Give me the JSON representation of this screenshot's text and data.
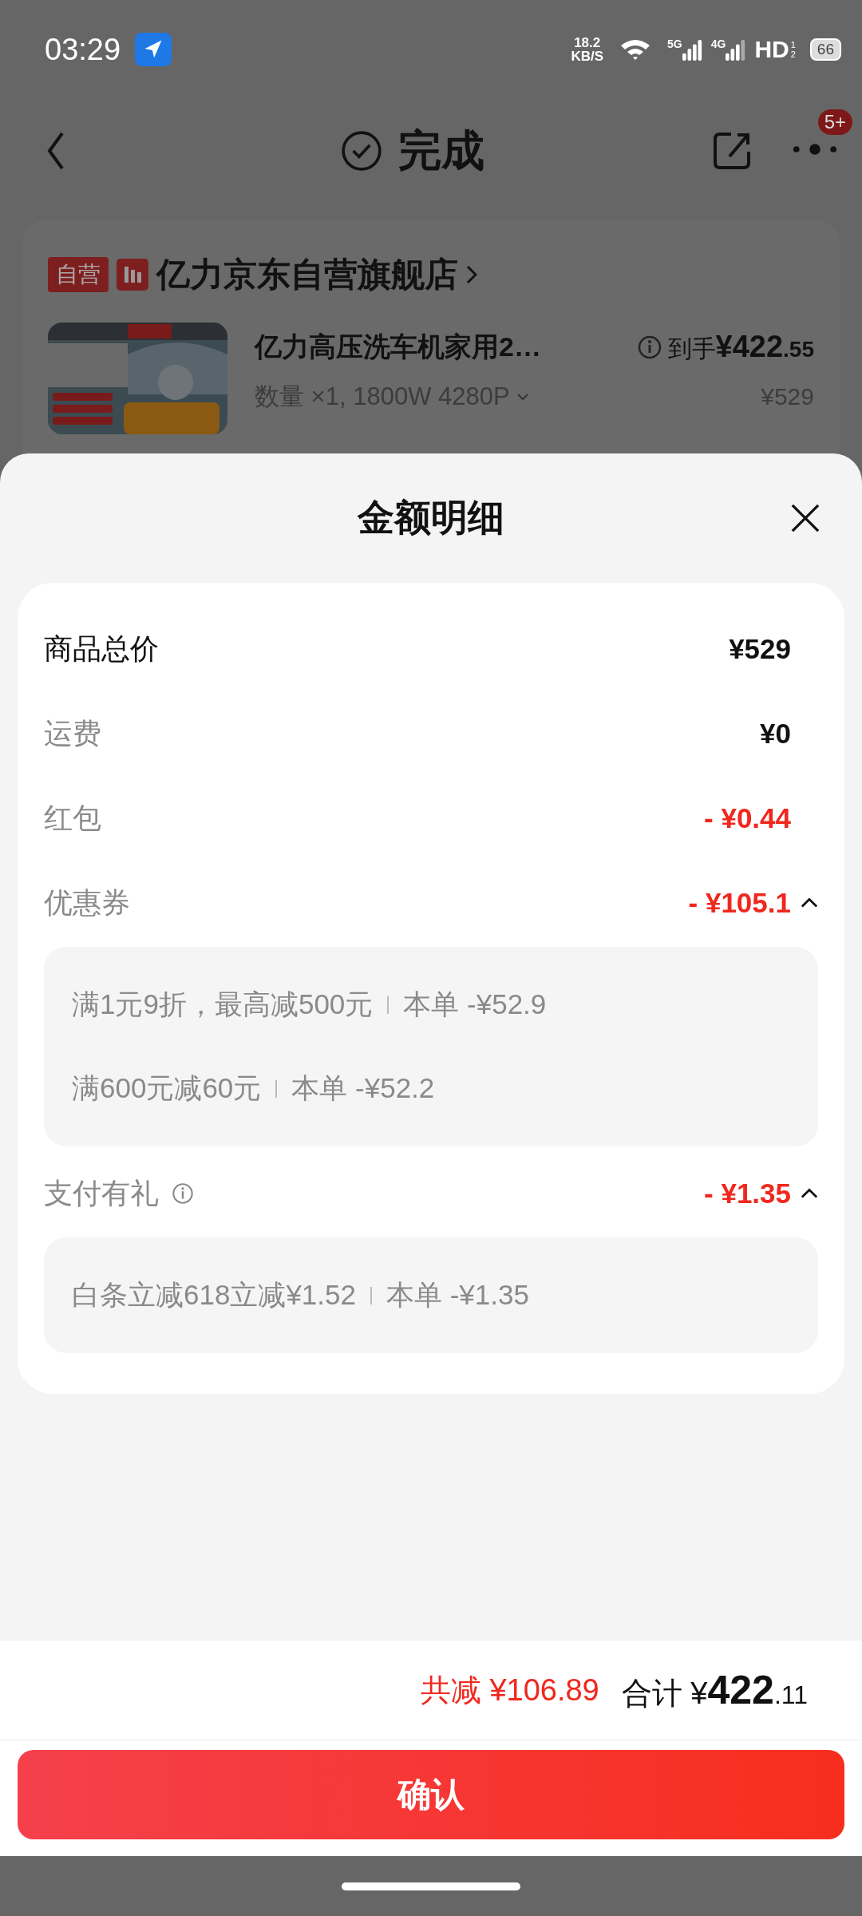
{
  "status_bar": {
    "time": "03:29",
    "speed_value": "18.2",
    "speed_unit": "KB/S",
    "sim1": "5G",
    "sim2": "4G",
    "hd": "HD",
    "hd_sims": [
      "1",
      "2"
    ],
    "battery": "66"
  },
  "header": {
    "title": "完成",
    "badge": "5+"
  },
  "store": {
    "tag": "自营",
    "name": "亿力京东自营旗舰店"
  },
  "product": {
    "title": "亿力高压洗车机家用2…",
    "spec": "数量 ×1, 1800W 4280P",
    "price_label": "到手",
    "price_int": "¥422",
    "price_dec": ".55",
    "original_price": "¥529"
  },
  "sheet": {
    "title": "金额明细",
    "rows": [
      {
        "kind": "total",
        "label": "商品总价",
        "value": "¥529"
      },
      {
        "kind": "charge",
        "label": "运费",
        "value": "¥0"
      },
      {
        "kind": "discount",
        "label": "红包",
        "value": "- ¥0.44"
      },
      {
        "kind": "discount",
        "label": "优惠券",
        "value": "- ¥105.1",
        "expanded": true,
        "details": [
          {
            "text": "满1元9折，最高减500元",
            "amount": "本单 -¥52.9"
          },
          {
            "text": "满600元减60元",
            "amount": "本单 -¥52.2"
          }
        ]
      },
      {
        "kind": "discount",
        "label": "支付有礼",
        "value": "- ¥1.35",
        "info": true,
        "expanded": true,
        "details": [
          {
            "text": "白条立减618立减¥1.52",
            "amount": "本单 -¥1.35"
          }
        ]
      }
    ]
  },
  "footer": {
    "saved_label": "共减",
    "saved_value": "¥106.89",
    "total_label": "合计",
    "total_currency": "¥",
    "total_int": "422",
    "total_dec": ".11",
    "confirm": "确认"
  }
}
